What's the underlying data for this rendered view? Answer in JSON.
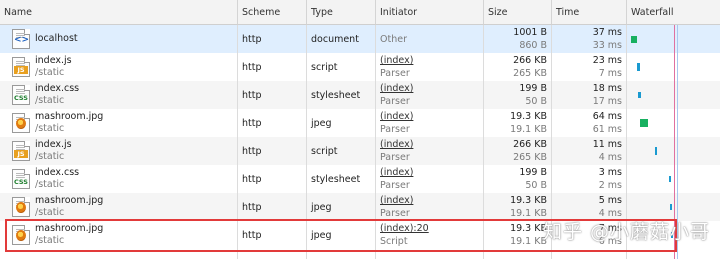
{
  "columns": [
    "Name",
    "Scheme",
    "Type",
    "Initiator",
    "Size",
    "Time",
    "Waterfall"
  ],
  "rows": [
    {
      "icon": "html-file-icon",
      "name": "localhost",
      "path": "",
      "scheme": "http",
      "type": "document",
      "initiator": "Other",
      "initiator_sub": "",
      "size": "1001 B",
      "size_sub": "860 B",
      "time": "37 ms",
      "time_sub": "33 ms",
      "selected": true
    },
    {
      "icon": "js-file-icon",
      "name": "index.js",
      "path": "/static",
      "scheme": "http",
      "type": "script",
      "initiator": "(index)",
      "initiator_sub": "Parser",
      "size": "266 KB",
      "size_sub": "265 KB",
      "time": "23 ms",
      "time_sub": "7 ms"
    },
    {
      "icon": "css-file-icon",
      "name": "index.css",
      "path": "/static",
      "scheme": "http",
      "type": "stylesheet",
      "initiator": "(index)",
      "initiator_sub": "Parser",
      "size": "199 B",
      "size_sub": "50 B",
      "time": "18 ms",
      "time_sub": "17 ms"
    },
    {
      "icon": "image-file-icon",
      "name": "mashroom.jpg",
      "path": "/static",
      "scheme": "http",
      "type": "jpeg",
      "initiator": "(index)",
      "initiator_sub": "Parser",
      "size": "19.3 KB",
      "size_sub": "19.1 KB",
      "time": "64 ms",
      "time_sub": "61 ms"
    },
    {
      "icon": "js-file-icon",
      "name": "index.js",
      "path": "/static",
      "scheme": "http",
      "type": "script",
      "initiator": "(index)",
      "initiator_sub": "Parser",
      "size": "266 KB",
      "size_sub": "265 KB",
      "time": "11 ms",
      "time_sub": "4 ms"
    },
    {
      "icon": "css-file-icon",
      "name": "index.css",
      "path": "/static",
      "scheme": "http",
      "type": "stylesheet",
      "initiator": "(index)",
      "initiator_sub": "Parser",
      "size": "199 B",
      "size_sub": "50 B",
      "time": "3 ms",
      "time_sub": "2 ms"
    },
    {
      "icon": "image-file-icon",
      "name": "mashroom.jpg",
      "path": "/static",
      "scheme": "http",
      "type": "jpeg",
      "initiator": "(index)",
      "initiator_sub": "Parser",
      "size": "19.3 KB",
      "size_sub": "19.1 KB",
      "time": "5 ms",
      "time_sub": "4 ms"
    },
    {
      "icon": "image-file-icon",
      "name": "mashroom.jpg",
      "path": "/static",
      "scheme": "http",
      "type": "jpeg",
      "initiator": "(index):20",
      "initiator_sub": "Script",
      "size": "19.3 KB",
      "size_sub": "19.1 KB",
      "time": "7 ms",
      "time_sub": "6 ms"
    }
  ],
  "waterfall": {
    "bar_color_waiting": "#18b060",
    "bar_color_download": "#1a9ad0",
    "marker_color": "#e070a0"
  },
  "watermark": "知乎 @小蘑菇小哥",
  "highlight_color": "#e23a3a"
}
